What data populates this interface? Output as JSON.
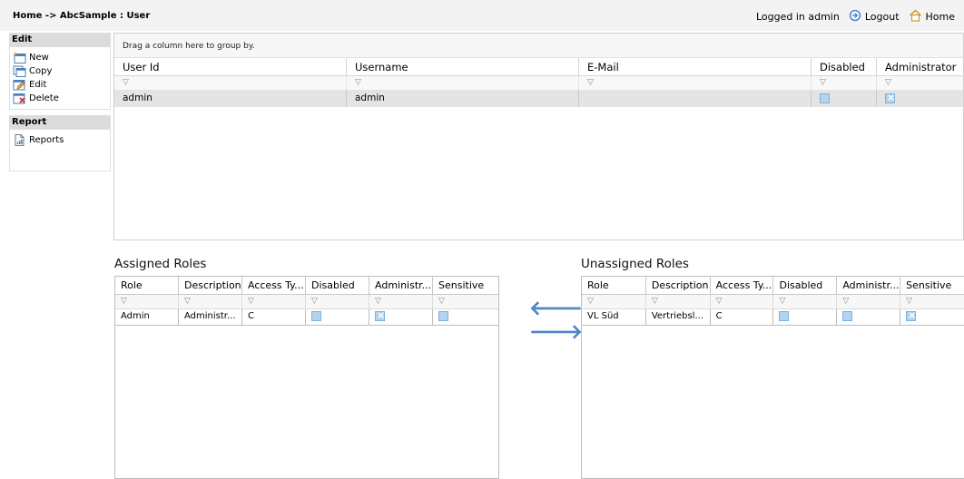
{
  "breadcrumb": "Home -> AbcSample : User",
  "header": {
    "logged_in": "Logged in admin",
    "logout": "Logout",
    "home": "Home"
  },
  "sidebar": {
    "edit_title": "Edit",
    "edit_items": [
      {
        "label": "New",
        "icon": "new-icon"
      },
      {
        "label": "Copy",
        "icon": "copy-icon"
      },
      {
        "label": "Edit",
        "icon": "edit-icon"
      },
      {
        "label": "Delete",
        "icon": "delete-icon"
      }
    ],
    "report_title": "Report",
    "report_items": [
      {
        "label": "Reports",
        "icon": "reports-icon"
      }
    ]
  },
  "users_grid": {
    "group_hint": "Drag a column here to group by.",
    "columns": [
      "User Id",
      "Username",
      "E-Mail",
      "Disabled",
      "Administrator"
    ],
    "rows": [
      {
        "user_id": "admin",
        "username": "admin",
        "email": "",
        "disabled": false,
        "administrator": true
      }
    ]
  },
  "assigned_roles": {
    "title": "Assigned Roles",
    "columns": [
      "Role",
      "Description",
      "Access Ty...",
      "Disabled",
      "Administr...",
      "Sensitive"
    ],
    "rows": [
      {
        "role": "Admin",
        "description": "Administr...",
        "access_type": "C",
        "disabled": false,
        "administrator": true,
        "sensitive": false
      }
    ]
  },
  "unassigned_roles": {
    "title": "Unassigned Roles",
    "columns": [
      "Role",
      "Description",
      "Access Ty...",
      "Disabled",
      "Administr...",
      "Sensitive"
    ],
    "rows": [
      {
        "role": "VL Süd",
        "description": "Vertriebsl...",
        "access_type": "C",
        "disabled": false,
        "administrator": false,
        "sensitive": true
      }
    ]
  },
  "colors": {
    "checkbox": "#b3d4ef",
    "arrow": "#4f86c6"
  }
}
